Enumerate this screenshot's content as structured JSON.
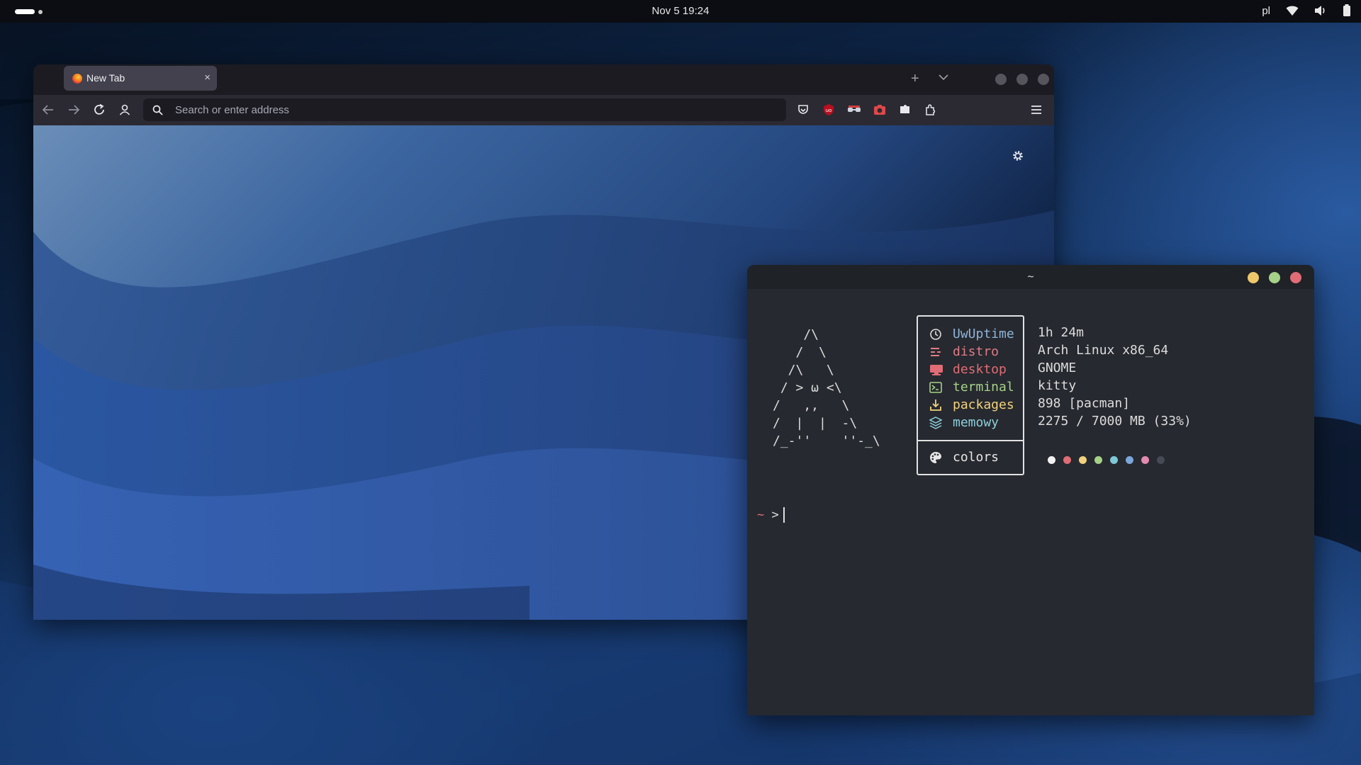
{
  "topbar": {
    "datetime": "Nov 5  19:24",
    "keyboard_layout": "pl",
    "icons": [
      "wifi-icon",
      "volume-icon",
      "battery-icon"
    ]
  },
  "browser": {
    "tab": {
      "title": "New Tab",
      "close": "×"
    },
    "new_tab": "+",
    "urlbar": {
      "placeholder": "Search or enter address"
    },
    "toolbar_icons": [
      "back-icon",
      "forward-icon",
      "reload-icon",
      "account-icon",
      "search-icon",
      "pocket-icon",
      "ublock-icon",
      "glasses-extension-icon",
      "screenshot-extension-icon",
      "puzzle-icon",
      "extensions-icon",
      "menu-icon"
    ],
    "settings_icon": "gear-icon"
  },
  "terminal": {
    "title": "~",
    "ascii_art": [
      "    /\\",
      "   /  \\",
      "  /\\   \\",
      " / > ω <\\",
      "/   ,,   \\",
      "/  |  |  -\\",
      "/_-''    ''-_\\"
    ],
    "fetch": [
      {
        "icon": "clock-icon",
        "label": "UwUptime",
        "value": "1h 24m",
        "color": "#8fb4d8"
      },
      {
        "icon": "distro-icon",
        "label": "distro",
        "value": "Arch Linux x86_64",
        "color": "#e07b85"
      },
      {
        "icon": "monitor-icon",
        "label": "desktop",
        "value": "GNOME",
        "color": "#e06c75"
      },
      {
        "icon": "terminal-icon",
        "label": "terminal",
        "value": "kitty",
        "color": "#a6d189"
      },
      {
        "icon": "download-icon",
        "label": "packages",
        "value": "898 [pacman]",
        "color": "#f2d17c"
      },
      {
        "icon": "layers-icon",
        "label": "memowy",
        "value": "2275 / 7000 MB (33%)",
        "color": "#8ccfdc"
      }
    ],
    "colors_row": {
      "icon": "palette-icon",
      "label": "colors",
      "color": "#e6e6e6"
    },
    "palette": [
      "#f2f2f2",
      "#e06c75",
      "#f2d17c",
      "#a6d189",
      "#7ec8d8",
      "#7aa6da",
      "#e28ab0",
      "#454a54"
    ],
    "prompt": {
      "tilde": "~",
      "arrow": ">",
      "tilde_color": "#e06c75",
      "arrow_color": "#e0e0e0"
    },
    "traffic_lights": [
      "#efc76b",
      "#a6d189",
      "#e06c75"
    ]
  }
}
